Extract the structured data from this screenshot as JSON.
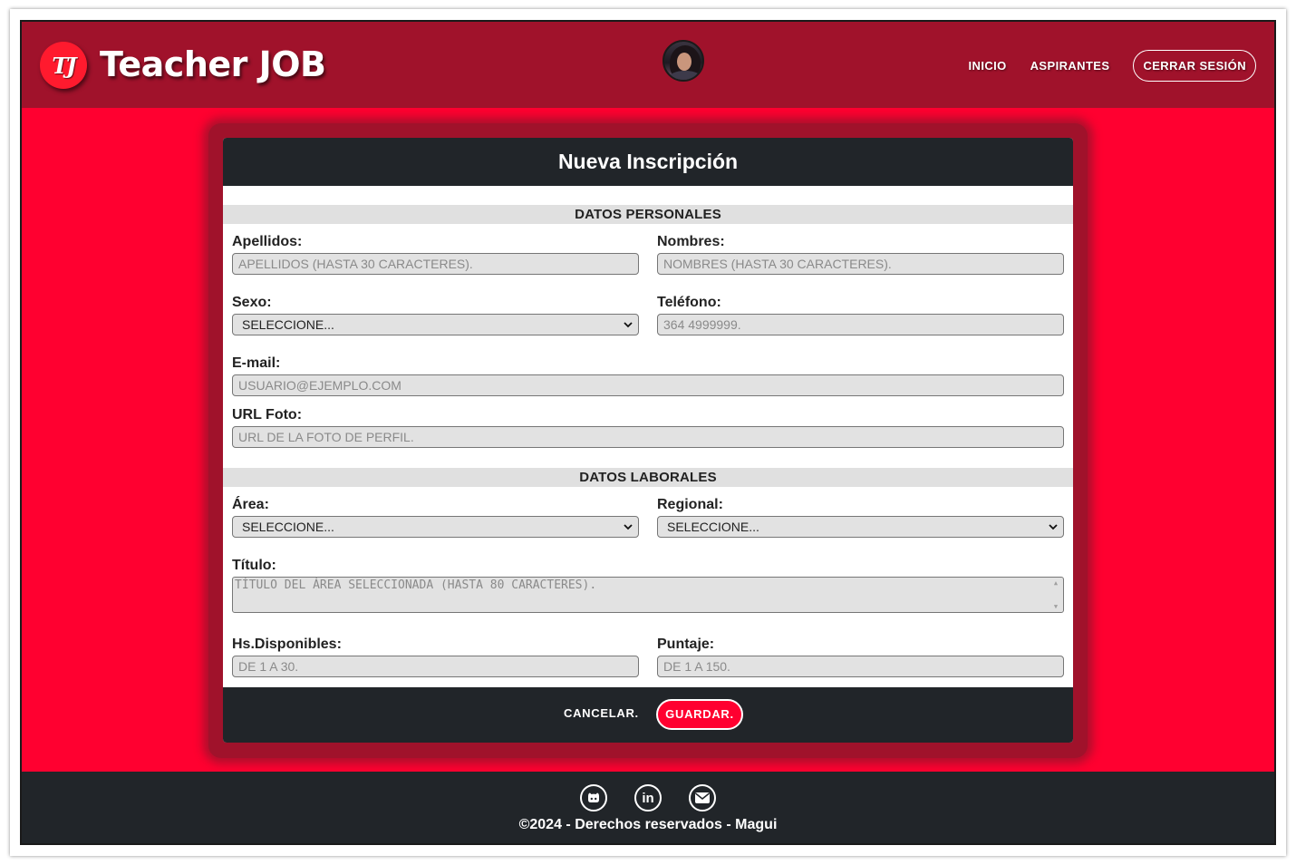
{
  "header": {
    "logo_mark": "TJ",
    "logo_text": "Teacher JOB",
    "nav": {
      "inicio": "INICIO",
      "aspirantes": "ASPIRANTES",
      "logout": "CERRAR SESIÓN"
    }
  },
  "form": {
    "title": "Nueva Inscripción",
    "sections": {
      "personal": "DATOS PERSONALES",
      "laboral": "DATOS LABORALES"
    },
    "fields": {
      "apellidos": {
        "label": "Apellidos:",
        "placeholder": "APELLIDOS (HASTA 30 CARACTERES)."
      },
      "nombres": {
        "label": "Nombres:",
        "placeholder": "NOMBRES (HASTA 30 CARACTERES)."
      },
      "sexo": {
        "label": "Sexo:",
        "value": "SELECCIONE..."
      },
      "telefono": {
        "label": "Teléfono:",
        "placeholder": "364 4999999."
      },
      "email": {
        "label": "E-mail:",
        "placeholder": "USUARIO@EJEMPLO.COM"
      },
      "url_foto": {
        "label": "URL Foto:",
        "placeholder": "URL DE LA FOTO DE PERFIL."
      },
      "area": {
        "label": "Área:",
        "value": "SELECCIONE..."
      },
      "regional": {
        "label": "Regional:",
        "value": "SELECCIONE..."
      },
      "titulo": {
        "label": "Título:",
        "placeholder": "TÍTULO DEL ÁREA SELECCIONADA (HASTA 80 CARACTERES)."
      },
      "hs_disponibles": {
        "label": "Hs.Disponibles:",
        "placeholder": "DE 1 A 30."
      },
      "puntaje": {
        "label": "Puntaje:",
        "placeholder": "DE 1 A 150."
      }
    },
    "buttons": {
      "cancel": "CANCELAR.",
      "save": "GUARDAR."
    }
  },
  "footer": {
    "social_icons": [
      "github-icon",
      "linkedin-icon",
      "email-icon"
    ],
    "copyright": "©2024 - Derechos reservados - Magui"
  },
  "colors": {
    "header_bg": "#a0122b",
    "page_bg": "#ff0030",
    "dark_bar": "#212529",
    "accent": "#ff0030"
  }
}
